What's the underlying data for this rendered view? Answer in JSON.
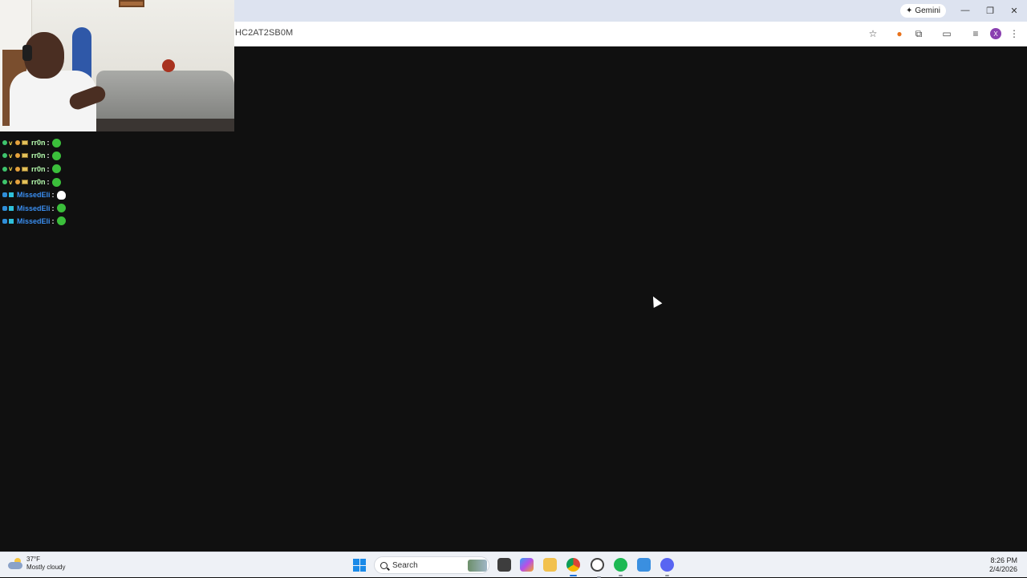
{
  "browser": {
    "url": "HC2AT2SB0M",
    "gemini_label": "Gemini",
    "avatar_letter": "X"
  },
  "chat": {
    "messages": [
      {
        "user": "rr0n",
        "color": "#b8ffb0",
        "emote": "leaf"
      },
      {
        "user": "rr0n",
        "color": "#b8ffb0",
        "emote": "leaf"
      },
      {
        "user": "rr0n",
        "color": "#b8ffb0",
        "emote": "leaf"
      },
      {
        "user": "rr0n",
        "color": "#b8ffb0",
        "emote": "leaf"
      },
      {
        "user": "MissedEli",
        "color": "#3a8ef0",
        "emote": "ghost"
      },
      {
        "user": "MissedEli",
        "color": "#3a8ef0",
        "emote": "leaf"
      },
      {
        "user": "MissedEli",
        "color": "#3a8ef0",
        "emote": "leaf"
      }
    ]
  },
  "taskbar": {
    "weather_temp": "37°F",
    "weather_desc": "Mostly cloudy",
    "search_placeholder": "Search",
    "time": "8:26 PM",
    "date": "2/4/2026"
  }
}
